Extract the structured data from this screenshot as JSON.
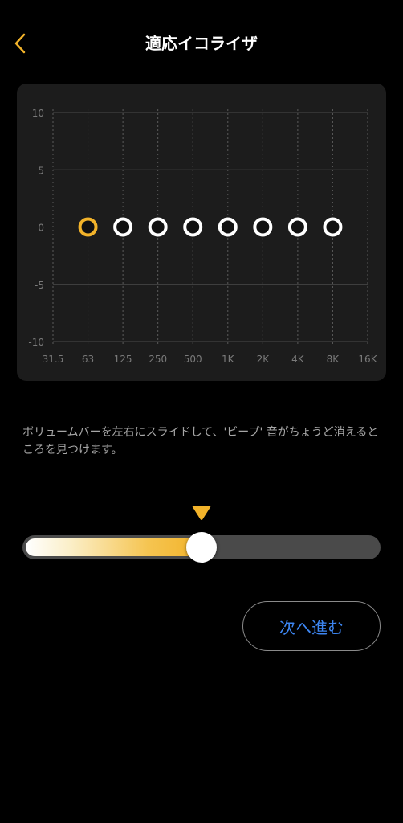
{
  "header": {
    "title": "適応イコライザ",
    "back_icon": "chevron-left-icon"
  },
  "colors": {
    "accent": "#f2b32a",
    "link": "#3d86f2",
    "card": "#1c1c1c",
    "background": "#000000"
  },
  "equalizer": {
    "y_ticks": [
      "10",
      "5",
      "0",
      "-5",
      "-10"
    ],
    "y_values": [
      10,
      5,
      0,
      -5,
      -10
    ],
    "x_ticks": [
      "31.5",
      "63",
      "125",
      "250",
      "500",
      "1K",
      "2K",
      "4K",
      "8K",
      "16K"
    ],
    "bands": [
      {
        "freq": "63",
        "gain": 0,
        "active": true
      },
      {
        "freq": "125",
        "gain": 0,
        "active": false
      },
      {
        "freq": "250",
        "gain": 0,
        "active": false
      },
      {
        "freq": "500",
        "gain": 0,
        "active": false
      },
      {
        "freq": "1K",
        "gain": 0,
        "active": false
      },
      {
        "freq": "2K",
        "gain": 0,
        "active": false
      },
      {
        "freq": "4K",
        "gain": 0,
        "active": false
      },
      {
        "freq": "8K",
        "gain": 0,
        "active": false
      }
    ]
  },
  "instruction": "ボリュームバーを左右にスライドして、'ビープ' 音がちょうど消えるところを見つけます。",
  "slider": {
    "value": 0.5
  },
  "next_button_label": "次へ進む"
}
